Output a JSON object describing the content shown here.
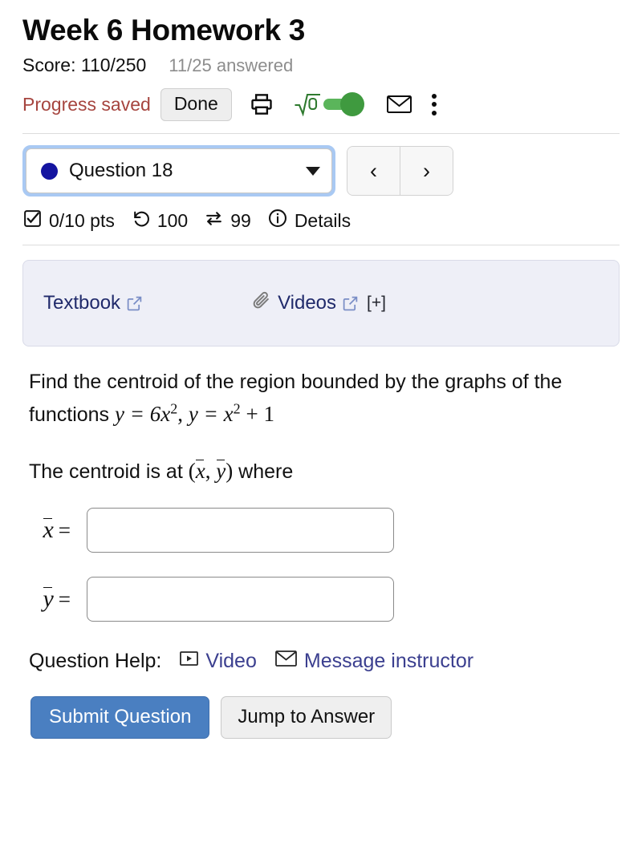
{
  "header": {
    "title": "Week 6 Homework 3",
    "score_label": "Score: 110/250",
    "answered_label": "11/25 answered"
  },
  "toolbar": {
    "progress_status": "Progress saved",
    "done_label": "Done",
    "print_icon": "printer-icon",
    "math_toggle_icon": "square-root-icon",
    "math_toggle_state": "on",
    "mail_icon": "envelope-icon",
    "more_icon": "kebab-menu-icon",
    "toggle_on_color": "#3f9a3f"
  },
  "question_nav": {
    "selected_question": "Question 18",
    "status_dot_color": "#1414a0",
    "focus_ring_color": "#a9c9f3",
    "prev_label": "‹",
    "next_label": "›"
  },
  "stats": {
    "points": "0/10 pts",
    "attempts_remaining": "100",
    "versions": "99",
    "details_label": "Details"
  },
  "resources": {
    "textbook_label": "Textbook",
    "videos_label": "Videos",
    "expand_label": "[+]",
    "panel_bg": "#eeeff7",
    "link_color": "#202a6b"
  },
  "question": {
    "prompt_line1": "Find the centroid of the region bounded by the graphs of",
    "prompt_line2_prefix": "the functions",
    "function1_base": "y = 6x",
    "function1_exp": "2",
    "function2_base": "y = x",
    "function2_exp": "2",
    "function2_tail": "+ 1",
    "centroid_prefix": "The centroid is at",
    "centroid_vars": "(x̄, ȳ)",
    "centroid_suffix": "where"
  },
  "answers": {
    "x_label": "x",
    "y_label": "y",
    "equals": "=",
    "x_value": "",
    "y_value": "",
    "x_placeholder": "",
    "y_placeholder": ""
  },
  "help": {
    "label": "Question Help:",
    "video_label": "Video",
    "message_label": "Message instructor",
    "video_icon": "video-play-icon",
    "message_icon": "envelope-icon",
    "link_color": "#3b3f8f"
  },
  "actions": {
    "submit_label": "Submit Question",
    "jump_label": "Jump to Answer",
    "submit_color": "#4a7fc1"
  }
}
